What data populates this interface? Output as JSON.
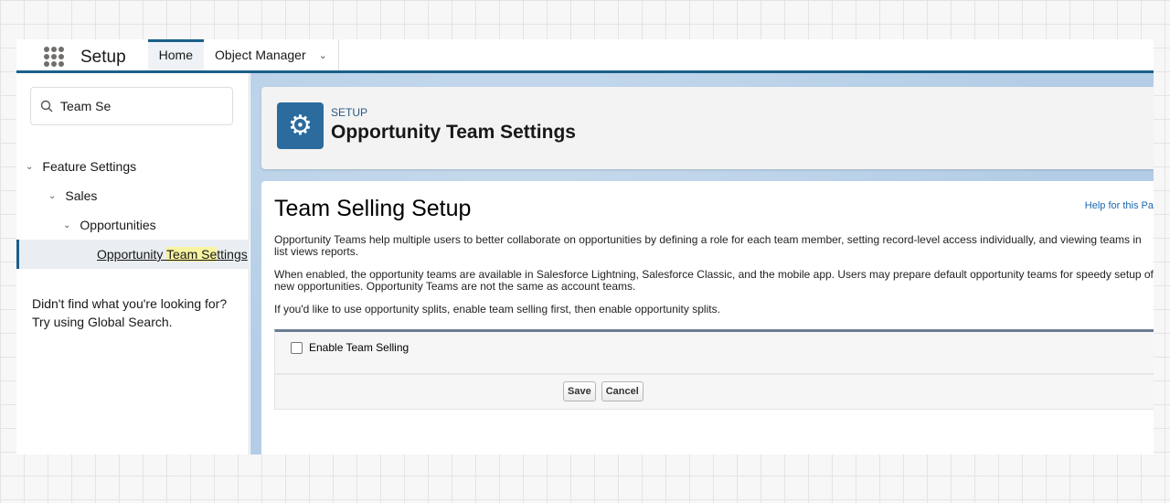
{
  "header": {
    "app_name": "Setup",
    "tabs": [
      {
        "label": "Home",
        "active": true
      },
      {
        "label": "Object Manager"
      }
    ]
  },
  "sidebar": {
    "search_value": "Team Se",
    "tree": [
      {
        "label": "Feature Settings"
      },
      {
        "label": "Sales"
      },
      {
        "label": "Opportunities"
      }
    ],
    "selected": {
      "pre": "Opportunity ",
      "match": "Team Se",
      "post": "ttings"
    },
    "help_line1": "Didn't find what you're looking for?",
    "help_line2": "Try using Global Search."
  },
  "page_header": {
    "breadcrumb": "SETUP",
    "title": "Opportunity Team Settings",
    "icon": "gear-icon"
  },
  "content": {
    "title": "Team Selling Setup",
    "help_link": "Help for this Pa",
    "p1": "Opportunity Teams help multiple users to better collaborate on opportunities by defining a role for each team member, setting record-level access individually, and viewing teams in list views reports.",
    "p2": "When enabled, the opportunity teams are available in Salesforce Lightning, Salesforce Classic, and the mobile app. Users may prepare default opportunity teams for speedy setup of new opportunities. Opportunity Teams are not the same as account teams.",
    "p3": "If you'd like to use opportunity splits, enable team selling first, then enable opportunity splits.",
    "checkbox_label": "Enable Team Selling",
    "checkbox_checked": false,
    "save": "Save",
    "cancel": "Cancel"
  },
  "colors": {
    "brand": "#1b5f8c",
    "link": "#1a67b3",
    "highlight": "#f8f3a0"
  }
}
